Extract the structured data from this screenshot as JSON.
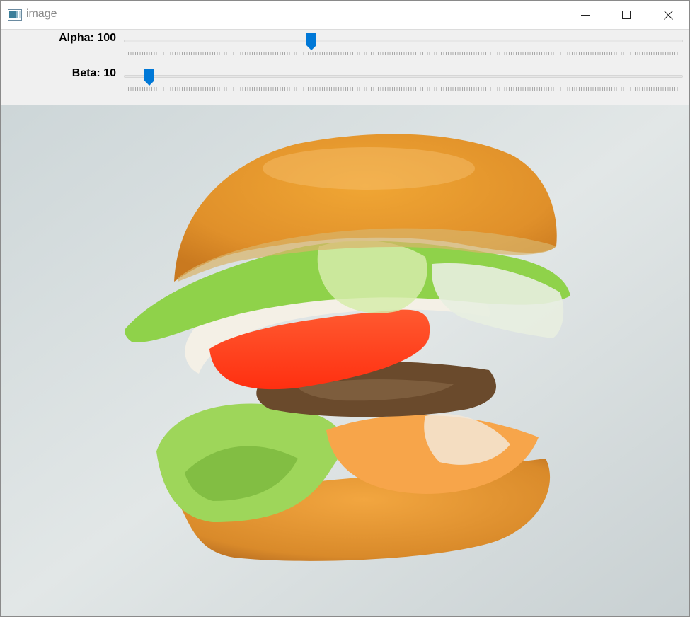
{
  "window": {
    "title": "image",
    "icon": "window-app-icon",
    "buttons": [
      "minimize-icon",
      "maximize-icon",
      "close-icon"
    ]
  },
  "trackbars": {
    "alpha": {
      "label": "Alpha: 100",
      "value": 100,
      "position_fraction": 0.335
    },
    "beta": {
      "label": "Beta: 10",
      "value": 10,
      "position_fraction": 0.046
    }
  },
  "image": {
    "subject": "burger"
  },
  "colors": {
    "accent": "#0078d7",
    "titlebar": "#ffffff",
    "panel": "#f0f0f0",
    "bun": "#e39a2c",
    "tomato": "#ff3a1f",
    "lettuce": "#8fd24a",
    "background": "#dfe4e4"
  }
}
